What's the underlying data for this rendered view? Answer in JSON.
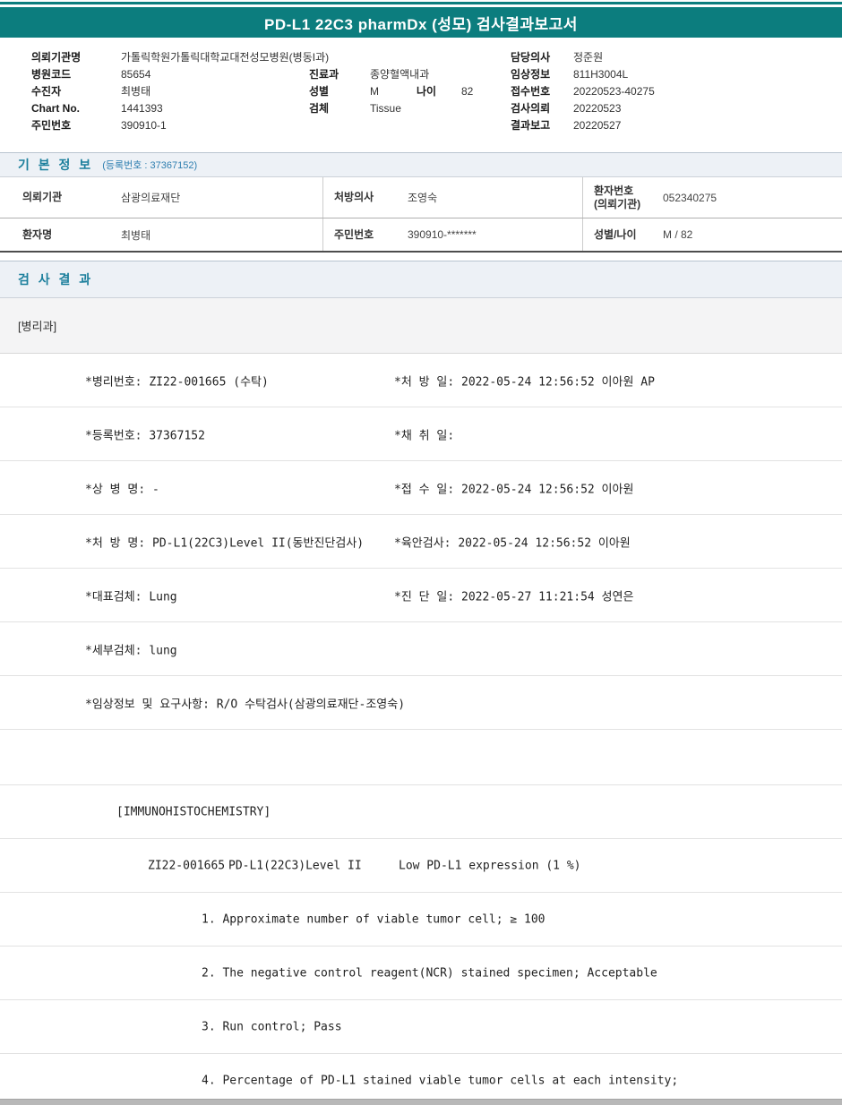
{
  "header": {
    "title": "PD-L1 22C3 pharmDx (성모) 검사결과보고서"
  },
  "patient": {
    "left": [
      {
        "label": "의뢰기관명",
        "value": "가톨릭학원가톨릭대학교대전성모병원(병동I과)"
      },
      {
        "label": "병원코드",
        "value": "85654"
      },
      {
        "label": "수진자",
        "value": "최병태"
      },
      {
        "label": "Chart No.",
        "value": "1441393"
      },
      {
        "label": "주민번호",
        "value": "390910-1"
      }
    ],
    "middle": [
      {
        "label": "진료과",
        "value": "종양혈액내과"
      },
      {
        "label": "성별",
        "value": "M"
      },
      {
        "label": "검체",
        "value": "Tissue"
      }
    ],
    "age": {
      "label": "나이",
      "value": "82"
    },
    "right": [
      {
        "label": "담당의사",
        "value": "정준원"
      },
      {
        "label": "임상정보",
        "value": "811H3004L"
      },
      {
        "label": "접수번호",
        "value": "20220523-40275"
      },
      {
        "label": "검사의뢰",
        "value": "20220523"
      },
      {
        "label": "결과보고",
        "value": "20220527"
      }
    ]
  },
  "basic_info": {
    "title": "기 본 정 보",
    "subtitle": "(등록번호 : 37367152)",
    "row1": {
      "c1_label": "의뢰기관",
      "c1_value": "삼광의료재단",
      "c2_label": "처방의사",
      "c2_value": "조영숙",
      "c3_label": "환자번호\n(의뢰기관)",
      "c3_value": "052340275"
    },
    "row2": {
      "c1_label": "환자명",
      "c1_value": "최병태",
      "c2_label": "주민번호",
      "c2_value": "390910-*******",
      "c3_label": "성별/나이",
      "c3_value": "M / 82"
    }
  },
  "results": {
    "title": "검 사 결 과",
    "department": "[병리과]",
    "details": [
      {
        "left": "*병리번호: ZI22-001665 (수탁)",
        "right": "*처 방 일: 2022-05-24 12:56:52  이아원 AP"
      },
      {
        "left": "*등록번호: 37367152",
        "right": "*채 취 일:"
      },
      {
        "left": "*상 병 명: -",
        "right": "*접 수 일: 2022-05-24 12:56:52  이아원"
      },
      {
        "left": "*처 방 명: PD-L1(22C3)Level II(동반진단검사)",
        "right": "*육안검사: 2022-05-24 12:56:52  이아원"
      },
      {
        "left": "*대표검체: Lung",
        "right": "*진 단 일: 2022-05-27 11:21:54  성연은"
      },
      {
        "left": "*세부검체: lung",
        "right": ""
      },
      {
        "left": "*임상정보 및 요구사항: R/O 수탁검사(삼광의료재단-조영숙)",
        "right": ""
      }
    ],
    "ihc": {
      "section": "[IMMUNOHISTOCHEMISTRY]",
      "specimen_no": "ZI22-001665",
      "test_name": "PD-L1(22C3)Level II",
      "result": "Low PD-L1 expression (1 %)",
      "items": [
        "1. Approximate number of viable tumor cell; ≥ 100",
        "2. The negative control reagent(NCR) stained specimen; Acceptable",
        "3. Run control; Pass",
        "4. Percentage of PD-L1 stained viable tumor cells at each intensity;"
      ]
    }
  }
}
